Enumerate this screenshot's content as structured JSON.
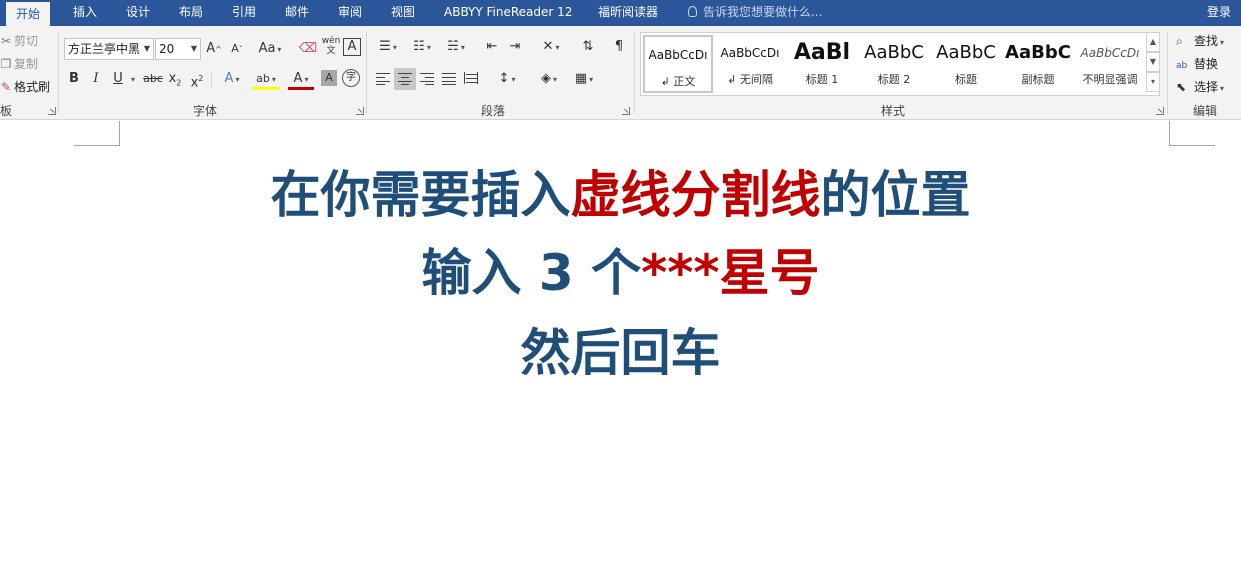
{
  "tabs": [
    "开始",
    "插入",
    "设计",
    "布局",
    "引用",
    "邮件",
    "审阅",
    "视图",
    "ABBYY FineReader 12",
    "福昕阅读器"
  ],
  "tell_me": "告诉我您想要做什么...",
  "login": "登录",
  "clipboard": {
    "cut": "剪切",
    "copy": "复制",
    "format_painter": "格式刷",
    "label": "板"
  },
  "font": {
    "name": "方正兰亭中黑",
    "size": "20",
    "label": "字体",
    "grow": "A",
    "shrink": "A",
    "change_case": "Aa",
    "phonetic": "wén",
    "phonetic_sub": "文",
    "char_border": "A",
    "bold": "B",
    "italic": "I",
    "underline": "U",
    "strikethrough": "abc",
    "subscript": "x",
    "subscript_mark": "2",
    "superscript": "x",
    "superscript_mark": "2",
    "text_effects": "A",
    "highlight": "ab",
    "font_color": "A",
    "char_shading": "A",
    "enclose": "字"
  },
  "paragraph": {
    "label": "段落"
  },
  "styles": {
    "label": "样式",
    "items": [
      {
        "sample": "AaBbCcDı",
        "name": "正文"
      },
      {
        "sample": "AaBbCcDı",
        "name": "无间隔"
      },
      {
        "sample": "AaBl",
        "name": "标题 1"
      },
      {
        "sample": "AaBbC",
        "name": "标题 2"
      },
      {
        "sample": "AaBbC",
        "name": "标题"
      },
      {
        "sample": "AaBbC",
        "name": "副标题"
      },
      {
        "sample": "AaBbCcDı",
        "name": "不明显强调"
      }
    ]
  },
  "editing": {
    "find": "查找",
    "replace": "替换",
    "select": "选择",
    "label": "编辑"
  },
  "document": {
    "line1_a": "在你需要插入",
    "line1_b": "虚线分割线",
    "line1_c": "的位置",
    "line2_a": "输入 3 个",
    "line2_b": "***星号",
    "line3": "然后回车"
  },
  "colors": {
    "accent": "#2b579a",
    "text_blue": "#1f4e79",
    "text_red": "#c00000"
  }
}
